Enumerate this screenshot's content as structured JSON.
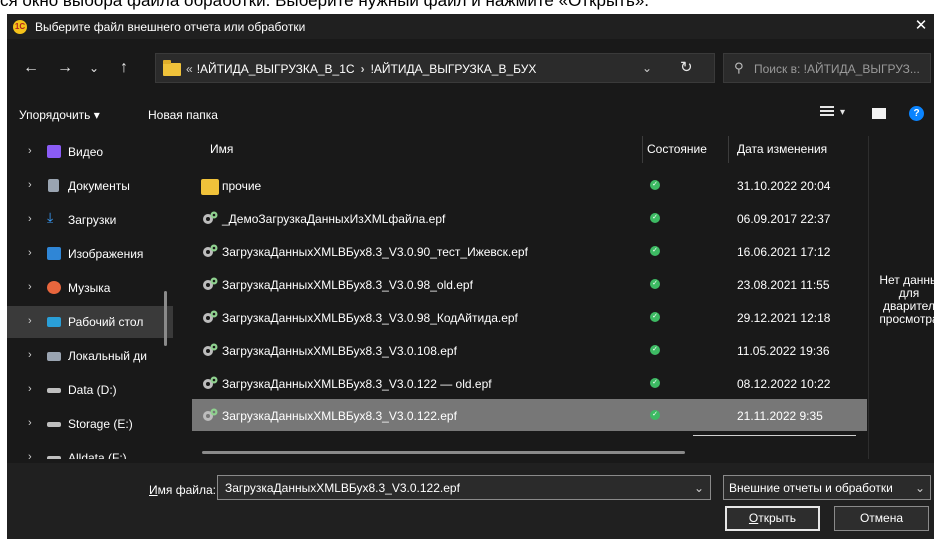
{
  "caption": "ся окно выбора файла обработки. Выберите нужный файл и нажмите «Открыть».",
  "window": {
    "logo": "1C",
    "title": "Выберите файл внешнего отчета или обработки",
    "close": "✕"
  },
  "address": {
    "lead": "«",
    "crumbs": [
      "!АЙТИДА_ВЫГРУЗКА_В_1С",
      "!АЙТИДА_ВЫГРУЗКА_В_БУХ"
    ],
    "separator": "›"
  },
  "search": {
    "placeholder": "Поиск в: !АЙТИДА_ВЫГРУЗ..."
  },
  "toolbar": {
    "organize": "Упорядочить ▾",
    "new_folder": "Новая папка",
    "help": "?"
  },
  "nav": [
    {
      "label": "Видео",
      "icon": "video-icon",
      "color": "#8b5cf6",
      "selected": false
    },
    {
      "label": "Документы",
      "icon": "document-icon",
      "color": "#9aa4b1",
      "selected": false
    },
    {
      "label": "Загрузки",
      "icon": "download-icon",
      "color": "#3aa0ff",
      "selected": false
    },
    {
      "label": "Изображения",
      "icon": "pictures-icon",
      "color": "#2f86d6",
      "selected": false
    },
    {
      "label": "Музыка",
      "icon": "music-icon",
      "color": "#e8663d",
      "selected": false
    },
    {
      "label": "Рабочий стол",
      "icon": "desktop-icon",
      "color": "#2a9fd8",
      "selected": true
    },
    {
      "label": "Локальный ди",
      "icon": "local-disk-icon",
      "color": "#9aa4b1",
      "selected": false
    },
    {
      "label": "Data (D:)",
      "icon": "drive-icon",
      "color": "#bfbfbf",
      "selected": false
    },
    {
      "label": "Storage (E:)",
      "icon": "drive-icon",
      "color": "#bfbfbf",
      "selected": false
    },
    {
      "label": "Alldata (F:)",
      "icon": "drive-icon",
      "color": "#bfbfbf",
      "selected": false
    }
  ],
  "columns": {
    "name": "Имя",
    "status": "Состояние",
    "date": "Дата изменения"
  },
  "files": [
    {
      "name": "прочие",
      "type": "folder",
      "date": "31.10.2022 20:04",
      "selected": false
    },
    {
      "name": "_ДемоЗагрузкаДанныхИзXMLфайла.epf",
      "type": "epf",
      "date": "06.09.2017 22:37",
      "selected": false
    },
    {
      "name": "ЗагрузкаДанныхXMLВБух8.3_V3.0.90_тест_Ижевск.epf",
      "type": "epf",
      "date": "16.06.2021 17:12",
      "selected": false
    },
    {
      "name": "ЗагрузкаДанныхXMLВБух8.3_V3.0.98_old.epf",
      "type": "epf",
      "date": "23.08.2021 11:55",
      "selected": false
    },
    {
      "name": "ЗагрузкаДанныхXMLВБух8.3_V3.0.98_КодАйтида.epf",
      "type": "epf",
      "date": "29.12.2021 12:18",
      "selected": false
    },
    {
      "name": "ЗагрузкаДанныхXMLВБух8.3_V3.0.108.epf",
      "type": "epf",
      "date": "11.05.2022 19:36",
      "selected": false
    },
    {
      "name": "ЗагрузкаДанныхXMLВБух8.3_V3.0.122 — old.epf",
      "type": "epf",
      "date": "08.12.2022 10:22",
      "selected": false
    },
    {
      "name": "ЗагрузкаДанныхXMLВБух8.3_V3.0.122.epf",
      "type": "epf",
      "date": "21.11.2022 9:35",
      "selected": true
    }
  ],
  "preview": {
    "text": [
      "Нет данны",
      "для",
      "дварител",
      "просмотра"
    ]
  },
  "bottom": {
    "filename_label_ul": "И",
    "filename_label_rest": "мя файла:",
    "filename_value": "ЗагрузкаДанныхXMLВБух8.3_V3.0.122.epf",
    "filter_value": "Внешние отчеты и обработки",
    "open_ul": "О",
    "open_rest": "ткрыть",
    "cancel": "Отмена"
  }
}
